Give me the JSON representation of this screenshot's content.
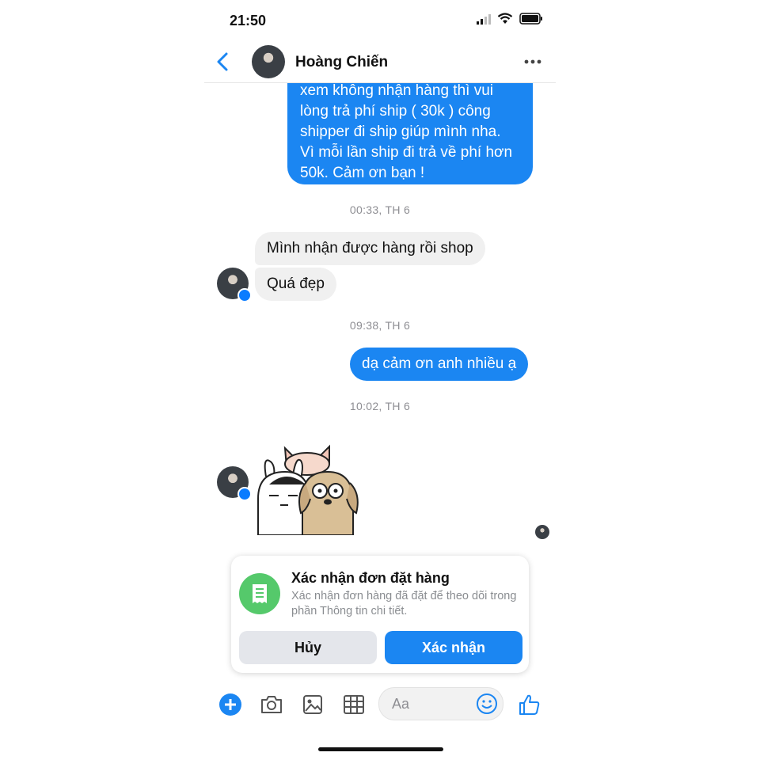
{
  "status_bar": {
    "time": "21:50"
  },
  "header": {
    "contact_name": "Hoàng Chiến"
  },
  "messages": {
    "outgoing_1": {
      "lines": [
        "xem không nhận hàng thì vui",
        "lòng trả phí ship ( 30k ) công",
        "shipper đi ship giúp mình nha.",
        "Vì mỗi lần ship đi trả về phí hơn",
        "50k. Cảm ơn bạn !"
      ]
    },
    "timestamp_1": "00:33, TH 6",
    "incoming_1": "Mình nhận được hàng rồi shop",
    "incoming_2": "Quá đẹp",
    "timestamp_2": "09:38, TH 6",
    "outgoing_2": "dạ cảm ơn anh nhiều ạ",
    "timestamp_3": "10:02, TH 6"
  },
  "order_card": {
    "title": "Xác nhận đơn đặt hàng",
    "description": "Xác nhận đơn hàng đã đặt để theo dõi trong phần Thông tin chi tiết.",
    "cancel_label": "Hủy",
    "confirm_label": "Xác nhận"
  },
  "composer": {
    "placeholder": "Aa"
  },
  "colors": {
    "accent": "#1b86f2",
    "incoming_bubble": "#f0f0f0",
    "card_icon": "#55c96b"
  },
  "icons": [
    "back-icon",
    "more-icon",
    "plus-icon",
    "camera-icon",
    "image-icon",
    "grid-icon",
    "emoji-icon",
    "thumbs-up-icon",
    "receipt-icon",
    "messenger-badge-icon",
    "wifi-icon",
    "battery-icon",
    "signal-icon"
  ]
}
